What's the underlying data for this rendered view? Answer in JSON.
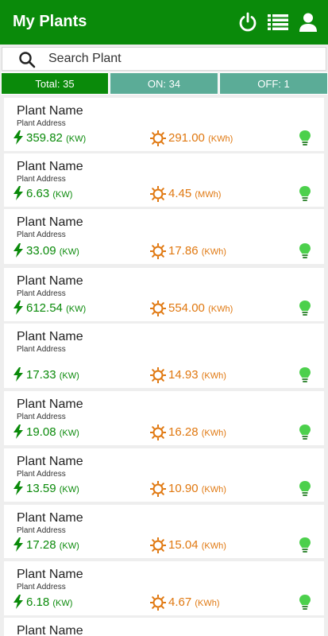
{
  "app": {
    "title": "My Plants"
  },
  "icons": {
    "power": "power-icon",
    "list": "list-icon",
    "user": "user-icon",
    "search": "search-icon",
    "bolt": "lightning-icon",
    "sun": "sun-icon",
    "bulb": "lightbulb-icon"
  },
  "colors": {
    "primary": "#0a8a0a",
    "tab_inactive": "#5bac97",
    "energy": "#e07810",
    "bulb": "#4cd04c"
  },
  "search": {
    "placeholder": "Search Plant"
  },
  "tabs": {
    "total": "Total: 35",
    "on": "ON: 34",
    "off": "OFF: 1"
  },
  "plants": [
    {
      "name": "Plant Name",
      "address": "Plant Address",
      "power": "359.82",
      "power_unit": "(KW)",
      "energy": "291.00",
      "energy_unit": "(KWh)",
      "status": "on"
    },
    {
      "name": "Plant Name",
      "address": "Plant Address",
      "power": "6.63",
      "power_unit": "(KW)",
      "energy": "4.45",
      "energy_unit": "(MWh)",
      "status": "on"
    },
    {
      "name": "Plant Name",
      "address": "Plant Address",
      "power": "33.09",
      "power_unit": "(KW)",
      "energy": "17.86",
      "energy_unit": "(KWh)",
      "status": "on"
    },
    {
      "name": "Plant Name",
      "address": "Plant Address",
      "power": "612.54",
      "power_unit": "(KW)",
      "energy": "554.00",
      "energy_unit": "(KWh)",
      "status": "on"
    },
    {
      "name": "Plant Name",
      "address": "Plant Address",
      "power": "17.33",
      "power_unit": "(KW)",
      "energy": "14.93",
      "energy_unit": "(KWh)",
      "status": "on"
    },
    {
      "name": "Plant Name",
      "address": "Plant Address",
      "power": "19.08",
      "power_unit": "(KW)",
      "energy": "16.28",
      "energy_unit": "(KWh)",
      "status": "on"
    },
    {
      "name": "Plant Name",
      "address": "Plant Address",
      "power": "13.59",
      "power_unit": "(KW)",
      "energy": "10.90",
      "energy_unit": "(KWh)",
      "status": "on"
    },
    {
      "name": "Plant Name",
      "address": "Plant Address",
      "power": "17.28",
      "power_unit": "(KW)",
      "energy": "15.04",
      "energy_unit": "(KWh)",
      "status": "on"
    },
    {
      "name": "Plant Name",
      "address": "Plant Address",
      "power": "6.18",
      "power_unit": "(KW)",
      "energy": "4.67",
      "energy_unit": "(KWh)",
      "status": "on"
    },
    {
      "name": "Plant Name"
    }
  ]
}
